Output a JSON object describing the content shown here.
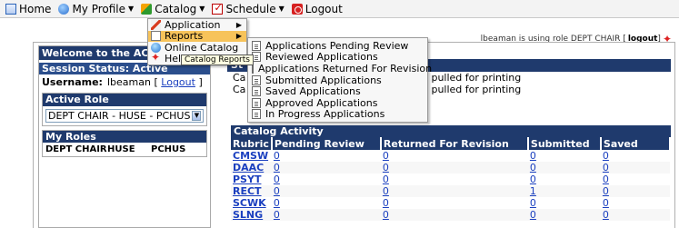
{
  "menubar": {
    "items": [
      {
        "label": "Home",
        "icon": "home-icon"
      },
      {
        "label": "My Profile",
        "icon": "profile-icon"
      },
      {
        "label": "Catalog",
        "icon": "catalog-icon"
      },
      {
        "label": "Schedule",
        "icon": "schedule-icon"
      },
      {
        "label": "Logout",
        "icon": "logout-icon"
      }
    ]
  },
  "catalog_menu": {
    "items": [
      {
        "label": "Application"
      },
      {
        "label": "Reports"
      },
      {
        "label": "Online Catalog"
      },
      {
        "label": "Help"
      }
    ],
    "tooltip": "Catalog Reports"
  },
  "reports_menu": {
    "items": [
      "Applications Pending Review",
      "Reviewed Applications",
      "Applications Returned For Revision",
      "Submitted Applications",
      "Saved Applications",
      "Approved Applications",
      "In Progress Applications"
    ]
  },
  "role_line": {
    "text": "lbeaman is using role DEPT CHAIR [",
    "logout": "logout",
    "close": "]"
  },
  "left_panel": {
    "welcome": "Welcome to the ACC Cu",
    "session_status": "Session Status: Active",
    "username_label": "Username:",
    "username_value": "lbeaman",
    "logout_link": "Logout",
    "active_role_title": "Active Role",
    "active_role_value": "DEPT CHAIR - HUSE - PCHUS",
    "my_roles_title": "My Roles",
    "my_roles_row": [
      "DEPT CHAIR",
      "HUSE",
      "PCHUS"
    ]
  },
  "status_panel": {
    "head": "St",
    "lines": [
      {
        "left": "Ca",
        "right": "n pulled for printing"
      },
      {
        "left": "Ca",
        "right": "n pulled for printing"
      }
    ]
  },
  "catalog_activity": {
    "title": "Catalog Activity",
    "columns": [
      "Rubric",
      "Pending Review",
      "Returned For Revision",
      "Submitted",
      "Saved"
    ],
    "rows": [
      [
        "CMSW",
        "0",
        "0",
        "0",
        "0"
      ],
      [
        "DAAC",
        "0",
        "0",
        "0",
        "0"
      ],
      [
        "PSYT",
        "0",
        "0",
        "0",
        "0"
      ],
      [
        "RECT",
        "0",
        "0",
        "1",
        "0"
      ],
      [
        "SCWK",
        "0",
        "0",
        "0",
        "0"
      ],
      [
        "SLNG",
        "0",
        "0",
        "0",
        "0"
      ]
    ]
  }
}
